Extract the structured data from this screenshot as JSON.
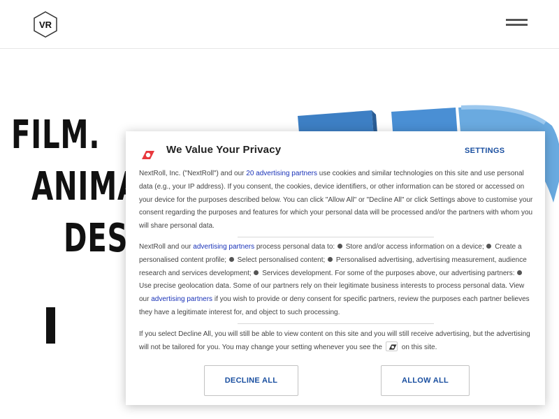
{
  "header": {
    "logo_text": "VR"
  },
  "hero": {
    "line1": "FILM.",
    "line2": "ANIMA",
    "line3": "DES"
  },
  "consent": {
    "title": "We Value Your Privacy",
    "settings_label": "SETTINGS",
    "p1_a": "NextRoll, Inc. (\"NextRoll\") and our ",
    "p1_link": "20 advertising partners",
    "p1_b": " use cookies and similar technologies on this site and use personal data (e.g., your IP address). If you consent, the cookies, device identifiers, or other information can be stored or accessed on your device for the purposes described below. You can click \"Allow All\" or \"Decline All\" or click Settings above to customise your consent regarding the purposes and features for which your personal data will be processed and/or the partners with whom you will share personal data.",
    "p2_a": "NextRoll and our ",
    "p2_link1": "advertising partners",
    "p2_b": " process personal data to: ",
    "p2_items": [
      "Store and/or access information on a device;",
      "Create a personalised content profile;",
      "Select personalised content;",
      "Personalised advertising, advertising measurement, audience research and services development;",
      "Services development. For some of the purposes above, our advertising partners:",
      "Use precise geolocation data. Some of our partners rely on their legitimate business interests to process personal data. View our "
    ],
    "p2_link2": "advertising partners",
    "p2_c": " if you wish to provide or deny consent for specific partners, review the purposes each partner believes they have a legitimate interest for, and object to such processing.",
    "p3_a": "If you select Decline All, you will still be able to view content on this site and you will still receive advertising, but the advertising will not be tailored for you. You may change your setting whenever you see the ",
    "p3_b": "on this site.",
    "decline_label": "DECLINE ALL",
    "allow_label": "ALLOW ALL"
  },
  "colors": {
    "accent_link": "#1a33b8",
    "button_text": "#1a4fa0",
    "brand_red": "#e8383d",
    "hero_blue": "#3d7fc4"
  },
  "icons": [
    "vr-logo-icon",
    "hamburger-menu-icon",
    "nextroll-logo-icon",
    "nextroll-settings-icon"
  ]
}
